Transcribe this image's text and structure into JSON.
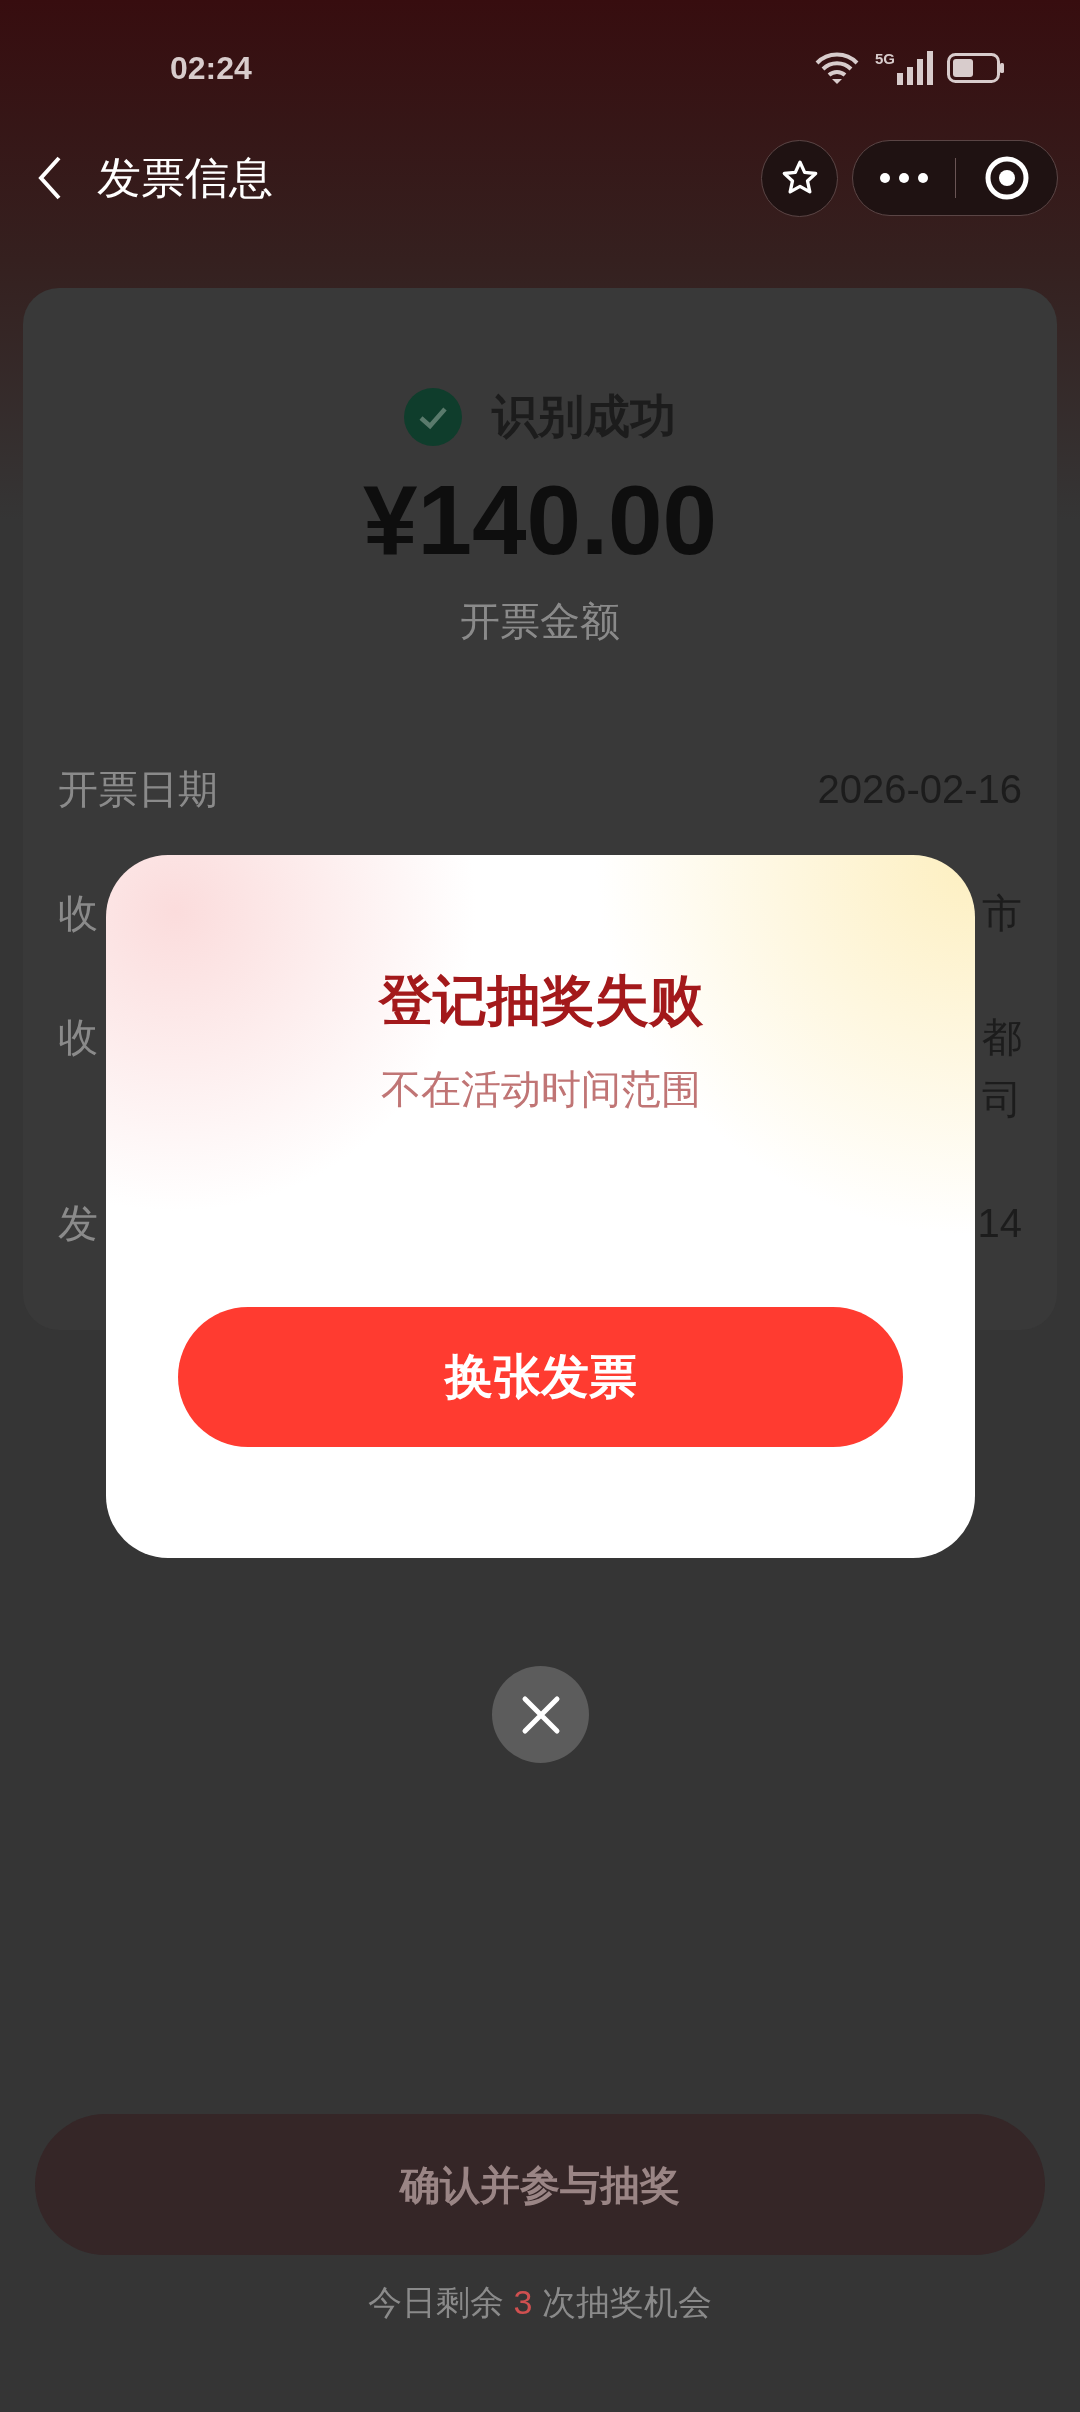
{
  "status_bar": {
    "time": "02:24",
    "network": "5G"
  },
  "nav": {
    "title": "发票信息"
  },
  "result": {
    "status": "识别成功",
    "amount": "¥140.00",
    "amount_label": "开票金额"
  },
  "rows": [
    {
      "label": "开票日期",
      "value": [
        "2026-02-16"
      ]
    },
    {
      "label": "收",
      "value": [
        "市"
      ]
    },
    {
      "label": "收",
      "value": [
        "都",
        "司"
      ]
    },
    {
      "label": "发",
      "value": [
        "14"
      ]
    }
  ],
  "confirm_button": {
    "label": "确认并参与抽奖"
  },
  "remaining": {
    "before": "今日剩余",
    "count": "3",
    "after": "次抽奖机会"
  },
  "dialog": {
    "title": "登记抽奖失败",
    "message": "不在活动时间范围",
    "button": "换张发票"
  }
}
